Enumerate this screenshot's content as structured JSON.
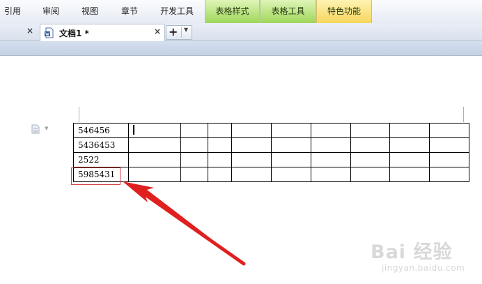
{
  "menu": {
    "items": [
      "引用",
      "审阅",
      "视图",
      "章节",
      "开发工具"
    ],
    "context_items": [
      "表格样式",
      "表格工具",
      "特色功能"
    ]
  },
  "tabs": {
    "active_title": "文档1 *",
    "close_glyph": "×",
    "new_tab_glyph": "+",
    "new_tab_caret": "▼"
  },
  "table": {
    "rows": [
      [
        "546456",
        "",
        "",
        "",
        "",
        "",
        "",
        "",
        "",
        ""
      ],
      [
        "5436453",
        "",
        "",
        "",
        "",
        "",
        "",
        "",
        "",
        ""
      ],
      [
        "2522",
        "",
        "",
        "",
        "",
        "",
        "",
        "",
        "",
        ""
      ],
      [
        "5985431",
        "",
        "",
        "",
        "",
        "",
        "",
        "",
        "",
        ""
      ]
    ]
  },
  "watermark": {
    "main": "Bai 经验",
    "sub": "jingyan.baidu.com"
  },
  "colors": {
    "ctx_green": "#9fd65a",
    "ctx_yellow": "#f7d65c",
    "arrow_red": "#e02020"
  }
}
